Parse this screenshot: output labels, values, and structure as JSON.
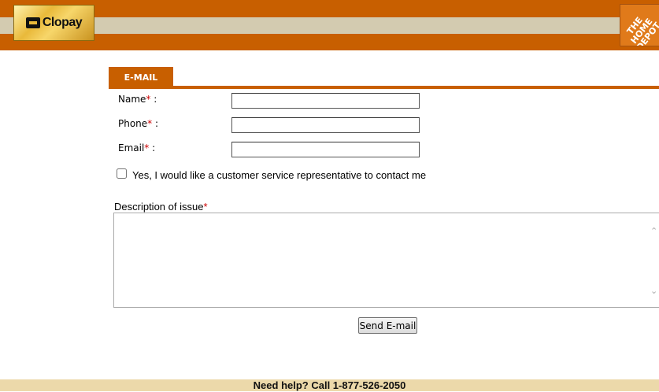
{
  "header": {
    "logo_text": "Clopay",
    "partner_logo_text": "THE HOME DEPOT"
  },
  "tab": {
    "label": "E-MAIL"
  },
  "form": {
    "name_label": "Name",
    "phone_label": "Phone",
    "email_label": "Email",
    "required_mark": "*",
    "colon": " :",
    "name_value": "",
    "phone_value": "",
    "email_value": "",
    "contact_checkbox_label": "Yes, I would like a customer service representative to contact me",
    "contact_checked": false,
    "description_label": "Description of issue",
    "description_value": "",
    "send_button_label": "Send E-mail"
  },
  "footer": {
    "help_text": "Need help? Call 1-877-526-2050"
  },
  "colors": {
    "brand_orange": "#c85f00",
    "header_stripe": "#d3cbb0",
    "footer_bg": "#ecd9aa",
    "required_red": "#cc0000"
  },
  "icons": [
    "scroll-up-icon",
    "scroll-down-icon",
    "clopay-logo-icon",
    "home-depot-logo-icon"
  ]
}
